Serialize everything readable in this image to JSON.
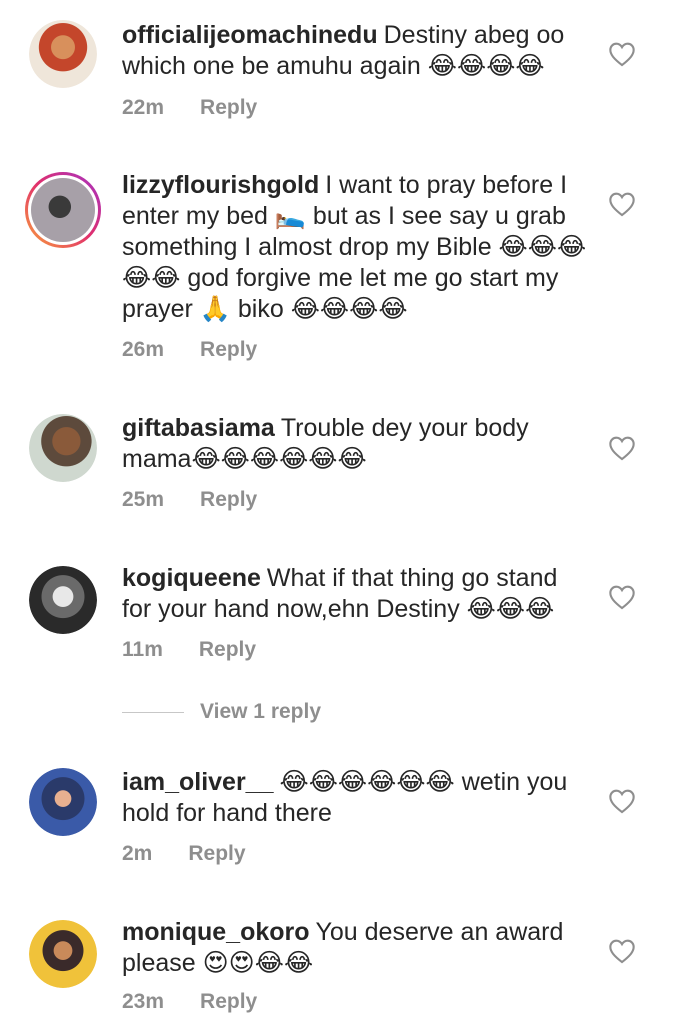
{
  "comments": [
    {
      "username": "officialijeomachinedu",
      "text": "Destiny abeg oo which one be amuhu again 😂😂😂😂",
      "time": "22m",
      "reply": "Reply"
    },
    {
      "username": "lizzyflourishgold",
      "text": "I want to pray before I enter my bed 🛌 but as I see say u grab something I almost drop my Bible 😂😂😂😂😂 god forgive me let me go start my prayer 🙏 biko 😂😂😂😂",
      "time": "26m",
      "reply": "Reply"
    },
    {
      "username": "giftabasiama",
      "text": "Trouble dey your body mama😂😂😂😂😂😂",
      "time": "25m",
      "reply": "Reply"
    },
    {
      "username": "kogiqueene",
      "text": "What if that thing go stand for your hand now,ehn Destiny 😂😂😂",
      "time": "11m",
      "reply": "Reply"
    },
    {
      "username": "iam_oliver__",
      "text": "😂😂😂😂😂😂 wetin you hold for hand there",
      "time": "2m",
      "reply": "Reply"
    },
    {
      "username": "monique_okoro",
      "text": "You deserve an award please 😍😍😂😂",
      "time": "23m",
      "reply": "Reply"
    }
  ],
  "view_replies": "View 1 reply",
  "icons": {
    "like": "heart-outline-icon"
  },
  "colors": {
    "text": "#262626",
    "meta": "#8e8e8e"
  }
}
